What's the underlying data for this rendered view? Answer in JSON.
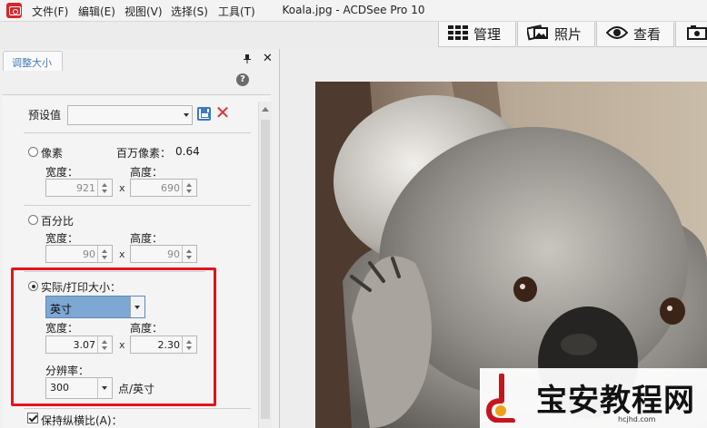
{
  "window": {
    "title": "Koala.jpg - ACDSee Pro 10",
    "menu": [
      "文件(F)",
      "编辑(E)",
      "视图(V)",
      "选择(S)",
      "工具(T)"
    ]
  },
  "modes": [
    {
      "label": "管理",
      "icon": "grid-icon"
    },
    {
      "label": "照片",
      "icon": "photo-icon"
    },
    {
      "label": "查看",
      "icon": "eye-icon"
    }
  ],
  "panel": {
    "tab_title": "调整大小",
    "preset_label": "预设值",
    "preset_value": "",
    "pixels": {
      "label": "像素",
      "megapixel_label": "百万像素：",
      "megapixel_value": "0.64",
      "width_label": "宽度：",
      "height_label": "高度：",
      "width": "921",
      "height": "690",
      "selected": false
    },
    "percent": {
      "label": "百分比",
      "width_label": "宽度：",
      "height_label": "高度：",
      "width": "90",
      "height": "90",
      "selected": false
    },
    "print_size": {
      "label": "实际/打印大小：",
      "unit": "英寸",
      "width_label": "宽度：",
      "height_label": "高度：",
      "width": "3.07",
      "height": "2.30",
      "resolution_label": "分辨率：",
      "resolution": "300",
      "resolution_unit": "点/英寸",
      "selected": true
    },
    "times_sign": "x",
    "keep_ratio_label": "保持纵横比(A)：",
    "keep_ratio_checked": true
  },
  "watermark": {
    "text": "宝安教程网",
    "url": "hcjhd.com"
  },
  "colors": {
    "highlight": "#e4141b",
    "accent": "#4a7ab4",
    "app_icon": "#d9262b"
  }
}
